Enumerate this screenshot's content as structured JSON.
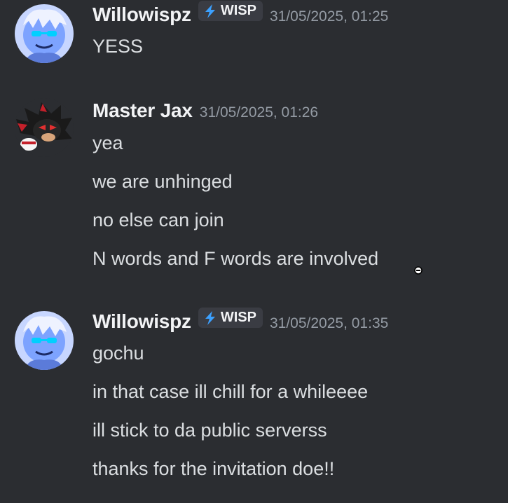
{
  "messages": [
    {
      "author": "Willowispz",
      "tag": "WISP",
      "timestamp": "31/05/2025, 01:25",
      "avatar_icon": "anime-avatar-blue",
      "lines": [
        "YESS"
      ]
    },
    {
      "author": "Master Jax",
      "timestamp": "31/05/2025, 01:26",
      "avatar_icon": "hedgehog-avatar",
      "lines": [
        "yea",
        "we are unhinged",
        "no else can join",
        "N words and F words are involved"
      ]
    },
    {
      "author": "Willowispz",
      "tag": "WISP",
      "timestamp": "31/05/2025, 01:35",
      "avatar_icon": "anime-avatar-blue",
      "lines": [
        "gochu",
        "in that case ill chill for a whileeee",
        "ill stick to da public serverss",
        "thanks for the invitation doe!!"
      ]
    }
  ],
  "colors": {
    "background": "#2b2d31",
    "username": "#f2f3f5",
    "timestamp": "#949ba4",
    "message_text": "#dbdee1",
    "tag_background": "#3a3c43",
    "bolt_icon": "#3ba0ff"
  }
}
